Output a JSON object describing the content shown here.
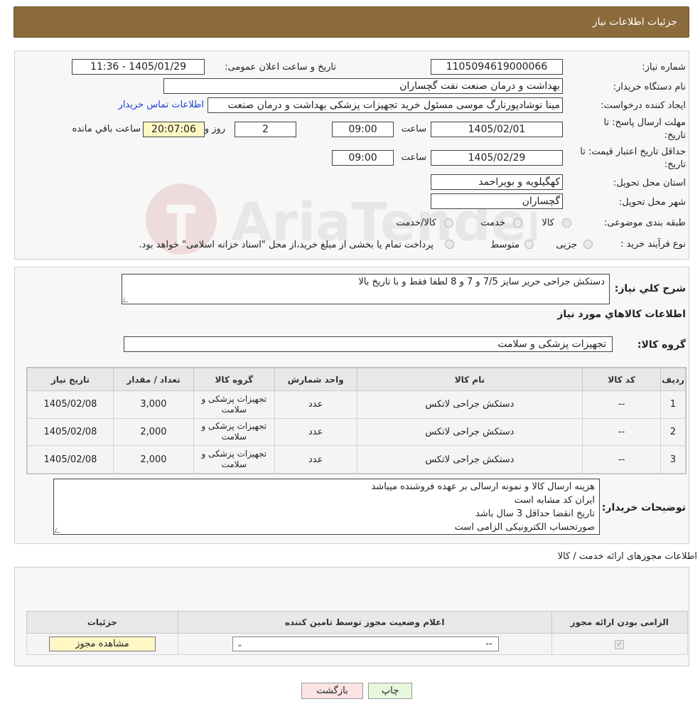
{
  "header": {
    "title": "جزئیات اطلاعات نیاز"
  },
  "info": {
    "need_number_label": "شماره نیاز:",
    "need_number": "1105094619000066",
    "announce_label": "تاریخ و ساعت اعلان عمومی:",
    "announce_value": "1405/01/29 - 11:36",
    "buyer_label": "نام دستگاه خریدار:",
    "buyer_value": "بهداشت و درمان صنعت نفت گچساران",
    "creator_label": "ایجاد کننده درخواست:",
    "creator_value": "مینا نوشادپورنارگ موسی مسئول خرید تجهیزات پزشکی  بهداشت و درمان صنعت",
    "contact_link": "اطلاعات تماس خریدار",
    "deadline_label_1": "مهلت ارسال پاسخ: تا",
    "deadline_label_2": "تاریخ:",
    "deadline_date": "1405/02/01",
    "time_label": "ساعت",
    "deadline_time": "09:00",
    "days_value": "2",
    "days_label": "روز و",
    "remaining_value": "20:07:06",
    "remaining_label": "ساعت باقي مانده",
    "validity_label_1": "حداقل تاریخ اعتبار قیمت: تا",
    "validity_label_2": "تاریخ:",
    "validity_date": "1405/02/29",
    "validity_time": "09:00",
    "province_label": "استان محل تحویل:",
    "province_value": "کهگیلویه و بویراحمد",
    "city_label": "شهر محل تحویل:",
    "city_value": "گچساران",
    "category_label": "طبقه بندی موضوعی:",
    "category_options": [
      "کالا",
      "خدمت",
      "کالا/خدمت"
    ],
    "process_label": "نوع فرآیند خرید :",
    "process_options": [
      "جزیی",
      "متوسط"
    ],
    "process_note": "پرداخت تمام یا بخشی از مبلغ خرید،از محل \"اسناد خزانه اسلامی\" خواهد بود."
  },
  "details": {
    "summary_label": "شرح کلي نياز:",
    "summary_value": "دستکش جراحی حریر سایز 7/5 و 7 و 8 لطفا فقط و با تاریخ بالا",
    "goods_title": "اطلاعات کالاهاي مورد نياز",
    "group_label": "گروه کالا:",
    "group_value": "تجهیزات پزشکی و سلامت",
    "table": {
      "headers": [
        "رديف",
        "کد کالا",
        "نام کالا",
        "واحد شمارش",
        "گروه کالا",
        "تعداد / مقدار",
        "تاریخ نیاز"
      ],
      "rows": [
        {
          "idx": "1",
          "code": "--",
          "name": "دستکش جراحی لاتکس",
          "unit": "عدد",
          "group": "تجهیزات پزشکی و سلامت",
          "qty": "3,000",
          "date": "1405/02/08"
        },
        {
          "idx": "2",
          "code": "--",
          "name": "دستکش جراحی لاتکس",
          "unit": "عدد",
          "group": "تجهیزات پزشکی و سلامت",
          "qty": "2,000",
          "date": "1405/02/08"
        },
        {
          "idx": "3",
          "code": "--",
          "name": "دستکش جراحی لاتکس",
          "unit": "عدد",
          "group": "تجهیزات پزشکی و سلامت",
          "qty": "2,000",
          "date": "1405/02/08"
        }
      ]
    },
    "notes_label": "توضیحات خریدار:",
    "notes_lines": [
      "هزینه ارسال کالا و نمونه ارسالی بر عهده فروشنده میباشد",
      "ایران کد مشابه است",
      "تاریخ انقضا حداقل 3 سال باشد",
      "صورتحساب الکترونیکی الزامی است"
    ]
  },
  "permits": {
    "section_title": "اطلاعات مجوزهای ارائه خدمت / کالا",
    "headers": [
      "الزامی بودن ارائه مجوز",
      "اعلام وضعیت مجوز توسط تامین کننده",
      "جزئیات"
    ],
    "select_value": "--",
    "view_button": "مشاهده مجوز"
  },
  "footer": {
    "print_button": "چاپ",
    "back_button": "بازگشت"
  },
  "watermark_text": "AriaTender.neT",
  "colors": {
    "header_bg": "#8b6a3c",
    "link": "#1a3fd8",
    "highlight_input": "#fff7c4",
    "back_button": "#fbe3e3",
    "print_button": "#e6f7dc"
  }
}
